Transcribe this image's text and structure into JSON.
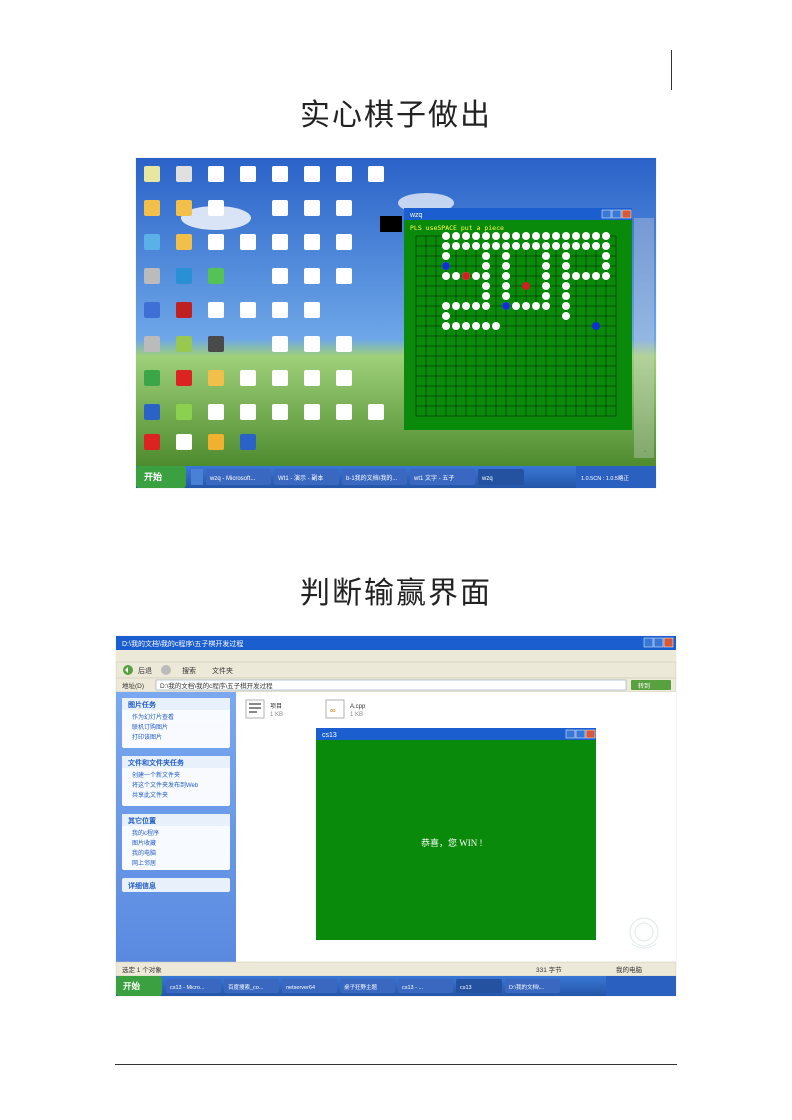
{
  "heading1": "实心棋子做出",
  "heading2": "判断输赢界面",
  "screenshot1": {
    "game_window_title": "wzq",
    "game_prompt": "PLS useSPACE put a piece",
    "taskbar_items": [
      "开始",
      "wzq - Microsoft...",
      "Wt1 - 演示 - 副本",
      "b-1我的文档\\我的...",
      "wt1 文字 - 五子",
      "wzq"
    ],
    "clock": "1.0.5CN : 1.0.5略正"
  },
  "screenshot2": {
    "explorer_title": "D:\\我的文档\\我的c程序\\五子棋开发过程",
    "address": "D:\\我的文档\\我的c程序\\五子棋开发过程",
    "toolbar": [
      "后退",
      "前进",
      "搜索",
      "文件夹"
    ],
    "sidebar_groups": [
      {
        "title": "图片任务",
        "items": [
          "作为幻灯片查看",
          "联机订购图片",
          "打印该图片"
        ]
      },
      {
        "title": "文件和文件夹任务",
        "items": [
          "创建一个新文件夹",
          "将这个文件夹发布到Web",
          "共享此文件夹"
        ]
      },
      {
        "title": "其它位置",
        "items": [
          "我的c程序",
          "图片收藏",
          "我的电脑",
          "网上邻居"
        ]
      },
      {
        "title": "详细信息",
        "items": []
      }
    ],
    "files": [
      {
        "name": "项目",
        "meta": "1 KB"
      },
      {
        "name": "A.cpp",
        "meta": "1 KB"
      }
    ],
    "game_window_title": "cs13",
    "game_message": "恭喜，您 WIN !",
    "statusbar_left": "选定 1 个对象",
    "statusbar_right": "我的电脑",
    "size_status": "331 字节",
    "taskbar_items": [
      "开始",
      "cs13 - Micro...",
      "百度搜索_co...",
      "netserver64",
      "桌子狂野主题",
      "cs13 - ...",
      "cs13",
      "D:\\我的文档\\..."
    ]
  }
}
